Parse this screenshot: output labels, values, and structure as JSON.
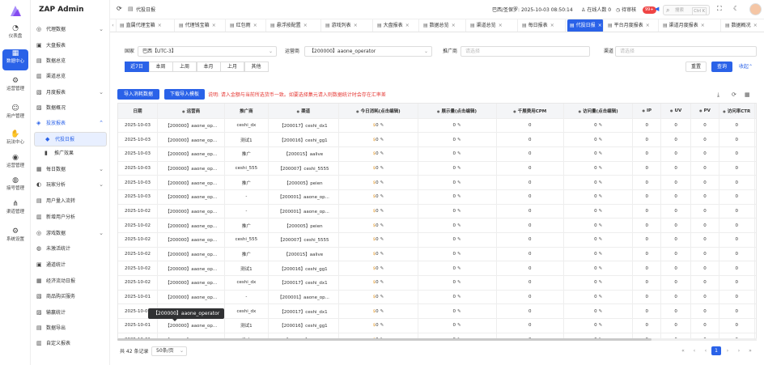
{
  "rail": {
    "items": [
      {
        "icon": "◔",
        "label": "仪表盘"
      },
      {
        "icon": "▦",
        "label": "数据中心"
      },
      {
        "icon": "⚙",
        "label": "运营管理"
      },
      {
        "icon": "☺",
        "label": "用户管理"
      },
      {
        "icon": "✋",
        "label": "玩法中心"
      },
      {
        "icon": "◉",
        "label": "运营管理"
      },
      {
        "icon": "◍",
        "label": "接号管理"
      },
      {
        "icon": "⋔",
        "label": "渠道管理"
      },
      {
        "icon": "⚙",
        "label": "系统设置"
      }
    ],
    "active_index": 1
  },
  "sidebar": {
    "brand": "ZAP Admin",
    "items": [
      {
        "icon": "◎",
        "label": "代理数据",
        "caret": "⌄"
      },
      {
        "icon": "▣",
        "label": "大盘报表",
        "caret": ""
      },
      {
        "icon": "▤",
        "label": "数据总览",
        "caret": ""
      },
      {
        "icon": "▥",
        "label": "渠道总览",
        "caret": ""
      },
      {
        "icon": "▧",
        "label": "月度报表",
        "caret": "⌄"
      },
      {
        "icon": "▨",
        "label": "数据概况",
        "caret": ""
      },
      {
        "icon": "◈",
        "label": "投放报表",
        "caret": "⌃"
      },
      {
        "icon": "◆",
        "label": "代投日报",
        "caret": ""
      },
      {
        "icon": "▮",
        "label": "推广效果",
        "caret": ""
      },
      {
        "icon": "▦",
        "label": "每日数据",
        "caret": "⌄"
      },
      {
        "icon": "◐",
        "label": "玩家分析",
        "caret": "⌄"
      },
      {
        "icon": "▤",
        "label": "用户量入流转",
        "caret": ""
      },
      {
        "icon": "▥",
        "label": "新增用户分析",
        "caret": ""
      },
      {
        "icon": "◎",
        "label": "游戏数据",
        "caret": "⌄"
      },
      {
        "icon": "◍",
        "label": "未激活统计",
        "caret": ""
      },
      {
        "icon": "▣",
        "label": "通道统计",
        "caret": ""
      },
      {
        "icon": "▦",
        "label": "经济流动日报",
        "caret": ""
      },
      {
        "icon": "▧",
        "label": "商品购买服务",
        "caret": ""
      },
      {
        "icon": "▨",
        "label": "输赢统计",
        "caret": ""
      },
      {
        "icon": "▤",
        "label": "数据导出",
        "caret": ""
      },
      {
        "icon": "▥",
        "label": "自定义报表",
        "caret": ""
      }
    ]
  },
  "topbar": {
    "refresh_icon": "refresh-icon",
    "page_title": "代投日报",
    "timezone": "巴西/圣保罗: 2025-10-03 08:50:14",
    "online_label": "在线人数",
    "online_count": "0",
    "pending_label": "待审核",
    "pending_badge": "99+",
    "search_placeholder": "搜索",
    "search_shortcut": "Ctrl K"
  },
  "tabs": [
    {
      "label": "直属代理宝箱",
      "active": false
    },
    {
      "label": "代理钱宝箱",
      "active": false
    },
    {
      "label": "红包雨",
      "active": false
    },
    {
      "label": "悬浮按配置",
      "active": false
    },
    {
      "label": "游戏列表",
      "active": false
    },
    {
      "label": "大盘报表",
      "active": false
    },
    {
      "label": "数据总览",
      "active": false
    },
    {
      "label": "渠道总览",
      "active": false
    },
    {
      "label": "每日报表",
      "active": false
    },
    {
      "label": "代投日报",
      "active": true
    },
    {
      "label": "平台月度报表",
      "active": false
    },
    {
      "label": "渠道月度报表",
      "active": false
    },
    {
      "label": "数据概况",
      "active": false
    }
  ],
  "filter": {
    "country_label": "国家",
    "country_value": "巴西【UTC-3】",
    "operator_label": "运营商",
    "operator_value": "【200000】aaone_operator",
    "promoter_label": "推广商",
    "promoter_placeholder": "请选择",
    "channel_label": "渠道",
    "channel_placeholder": "请选择",
    "quick": [
      "近7日",
      "本周",
      "上周",
      "本月",
      "上月",
      "其他"
    ],
    "quick_active": 0,
    "reset_label": "重置",
    "query_label": "查询",
    "collapse_label": "收起"
  },
  "toolbar": {
    "import_label": "导入消耗数据",
    "download_label": "下载导入模板",
    "warning": "说明: 请入金额与当前所选货币一致。如要选择集元请入则数据统计时会存在汇率差"
  },
  "table": {
    "headers": [
      "日期",
      "运营商",
      "推广商",
      "渠道",
      "今日消耗(点击编辑)",
      "展示量(点击编辑)",
      "千展费用CPM",
      "访问量(点击编辑)",
      "IP",
      "UV",
      "PV",
      "访问率CTR",
      "平均访问量CPC",
      "新"
    ],
    "rows": [
      [
        "2025-10-03",
        "【200000】aaone_op...",
        "ceshi_dx",
        "【200017】ceshi_dx1",
        "0",
        "0",
        "0",
        "0",
        "0",
        "0",
        "0",
        "0",
        "0"
      ],
      [
        "2025-10-03",
        "【200000】aaone_op...",
        "测试1",
        "【200016】ceshi_gg1",
        "0",
        "0",
        "0",
        "0",
        "0",
        "0",
        "0",
        "0",
        "0"
      ],
      [
        "2025-10-03",
        "【200000】aaone_op...",
        "推广",
        "【200015】aalive",
        "0",
        "0",
        "0",
        "0",
        "0",
        "0",
        "0",
        "0",
        "0"
      ],
      [
        "2025-10-03",
        "【200000】aaone_op...",
        "ceshi_555",
        "【200007】ceshi_5555",
        "0",
        "0",
        "0",
        "0",
        "0",
        "0",
        "0",
        "0",
        "0"
      ],
      [
        "2025-10-03",
        "【200000】aaone_op...",
        "推广",
        "【200005】peien",
        "0",
        "0",
        "0",
        "0",
        "0",
        "0",
        "0",
        "0",
        "0"
      ],
      [
        "2025-10-03",
        "【200000】aaone_op...",
        "-",
        "【200001】aaone_op...",
        "0",
        "0",
        "0",
        "0",
        "0",
        "0",
        "0",
        "0",
        "0"
      ],
      [
        "2025-10-02",
        "【200000】aaone_op...",
        "-",
        "【200001】aaone_op...",
        "0",
        "0",
        "0",
        "0",
        "0",
        "0",
        "0",
        "0",
        "0"
      ],
      [
        "2025-10-02",
        "【200000】aaone_op...",
        "推广",
        "【200005】peien",
        "0",
        "0",
        "0",
        "0",
        "0",
        "0",
        "0",
        "0",
        "0"
      ],
      [
        "2025-10-02",
        "【200000】aaone_op...",
        "ceshi_555",
        "【200007】ceshi_5555",
        "0",
        "0",
        "0",
        "0",
        "0",
        "0",
        "0",
        "0",
        "0"
      ],
      [
        "2025-10-02",
        "【200000】aaone_op...",
        "推广",
        "【200015】aalive",
        "0",
        "0",
        "0",
        "0",
        "0",
        "0",
        "0",
        "0",
        "0"
      ],
      [
        "2025-10-02",
        "【200000】aaone_op...",
        "测试1",
        "【200016】ceshi_gg1",
        "0",
        "0",
        "0",
        "0",
        "0",
        "0",
        "0",
        "0",
        "0"
      ],
      [
        "2025-10-02",
        "【200000】aaone_op...",
        "ceshi_dx",
        "【200017】ceshi_dx1",
        "0",
        "0",
        "0",
        "0",
        "0",
        "0",
        "0",
        "0",
        "0"
      ],
      [
        "2025-10-01",
        "【200000】aaone_op...",
        "-",
        "【200001】aaone_op...",
        "0",
        "0",
        "0",
        "0",
        "0",
        "0",
        "0",
        "0",
        "0"
      ],
      [
        "2025-10-01",
        "【200000】aaone_op...",
        "ceshi_dx",
        "【200017】ceshi_dx1",
        "0",
        "0",
        "0",
        "0",
        "0",
        "0",
        "0",
        "0",
        "0"
      ],
      [
        "2025-10-01",
        "【200000】aaone_op...",
        "测试1",
        "【200016】ceshi_gg1",
        "0",
        "0",
        "0",
        "0",
        "0",
        "0",
        "0",
        "0",
        "0"
      ],
      [
        "2025-10-01",
        "【200000】aaone_op...",
        "推广",
        "【200015】aalive",
        "0",
        "0",
        "0",
        "0",
        "0",
        "0",
        "0",
        "0",
        "0"
      ]
    ],
    "tooltip": "【200000】aaone_operator"
  },
  "footer": {
    "total": "共 42 条记录",
    "page_size": "50条/页",
    "current_page": "1"
  }
}
